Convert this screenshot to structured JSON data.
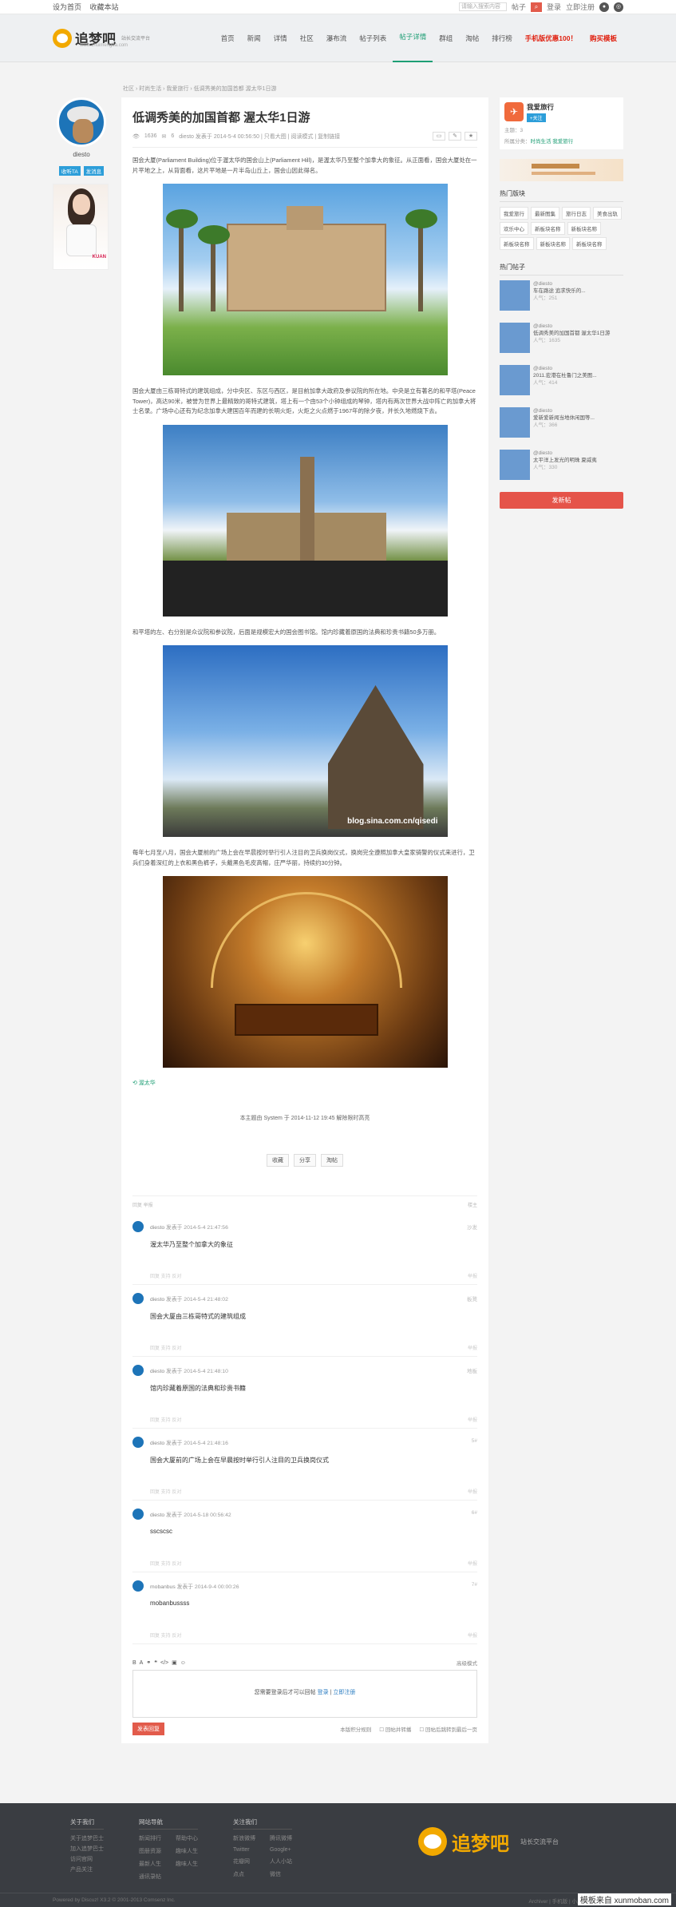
{
  "topbar": {
    "links": [
      "设为首页",
      "收藏本站"
    ],
    "search_placeholder": "请输入搜索内容",
    "search_scope": "帖子",
    "login": "登录",
    "register": "立即注册"
  },
  "header": {
    "logo_text": "追梦吧",
    "logo_sub": "站长交流平台",
    "logo_url": "www.zhuimengba.com"
  },
  "nav": [
    {
      "label": "首页"
    },
    {
      "label": "新闻"
    },
    {
      "label": "详情"
    },
    {
      "label": "社区"
    },
    {
      "label": "瀑布流"
    },
    {
      "label": "帖子列表"
    },
    {
      "label": "帖子详情",
      "active": true
    },
    {
      "label": "群组"
    },
    {
      "label": "淘帖"
    },
    {
      "label": "排行榜"
    },
    {
      "label": "手机版优惠100！",
      "red": true
    },
    {
      "label": "购买模板",
      "red": true
    }
  ],
  "breadcrumb": "社区 › 时尚生活 › 我爱旅行 › 低调秀美的加国首都 渥太华1日游",
  "author": {
    "name": "diesto",
    "btn_follow": "收听TA",
    "btn_msg": "发消息",
    "ad_tag": "KUAN"
  },
  "post": {
    "title": "低调秀美的加国首都 渥太华1日游",
    "views": "1636",
    "replies": "6",
    "meta": "diesto 发表于 2014-5-4 00:56:50 | 只看大图 | 阅读模式 | 复制链接",
    "p1": "国会大厦(Parliament Building)位于渥太华的国会山上(Parliament Hill)，是渥太华乃至整个加拿大的象征。从正面看，国会大厦处在一片平地之上，从背面看，这片平地是一片半岛山丘上，国会山因此得名。",
    "p2": "国会大厦由三栋哥特式的建筑组成，分中央区、东区与西区，是目前加拿大政府及参议院的所在地。中央是立有著名的和平塔(Peace Tower)，高达90米，被誉为世界上最精致的哥特式建筑，塔上有一个由53个小钟组成的琴钟，塔内有两次世界大战中阵亡的加拿大将士名录。广场中心还有为纪念加拿大建国百年而建的长明火炬，火炬之火点燃于1967年的除夕夜，并长久地燃烧下去。",
    "p3": "和平塔的左、右分别是众议院和参议院，后面是规模宏大的国会图书馆。馆内珍藏着原国的法典和珍贵书籍50多万册。",
    "watermark": "blog.sina.com.cn/qisedi",
    "p4": "每年七月至八月，国会大厦前的广场上会在早晨按时举行引人注目的卫兵换岗仪式，换岗完全遵照加拿大皇家骑警的仪式来进行，卫兵们身着深红的上衣和黑色裤子，头戴黑色毛皮高帽，庄严华丽，持续约30分钟。",
    "tag": "渥太华",
    "sysmsg": "本主题由 System 于 2014-11-12 19:45 解除限时高亮",
    "actions": [
      "收藏",
      "分享",
      "淘帖"
    ],
    "reply_bar_left": "回复  举报",
    "reply_bar_right": "楼主"
  },
  "comments": [
    {
      "author": "diesto",
      "time": "发表于 2014-5-4 21:47:56",
      "floor": "沙发",
      "text": "渥太华乃至整个加拿大的象征",
      "foot": "回复  支持  反对",
      "report": "举报"
    },
    {
      "author": "diesto",
      "time": "发表于 2014-5-4 21:48:02",
      "floor": "板凳",
      "text": "国会大厦由三栋哥特式的建筑组成",
      "foot": "回复  支持  反对",
      "report": "举报"
    },
    {
      "author": "diesto",
      "time": "发表于 2014-5-4 21:48:10",
      "floor": "地板",
      "text": "馆内珍藏着原国的法典和珍贵书籍",
      "foot": "回复  支持  反对",
      "report": "举报"
    },
    {
      "author": "diesto",
      "time": "发表于 2014-5-4 21:48:16",
      "floor": "5#",
      "text": "国会大厦前的广场上会在早晨按时举行引人注目的卫兵换岗仪式",
      "foot": "回复  支持  反对",
      "report": "举报"
    },
    {
      "author": "diesto",
      "time": "发表于 2014-5-18 00:56:42",
      "floor": "6#",
      "text": "sscscsc",
      "foot": "回复  支持  反对",
      "report": "举报"
    },
    {
      "author": "mobanbus",
      "time": "发表于 2014-9-4 00:00:26",
      "floor": "7#",
      "text": "mobanbussss",
      "foot": "回复  支持  反对",
      "report": "举报"
    }
  ],
  "editor": {
    "adv": "高级模式",
    "msg": "您需要登录后才可以回帖",
    "login": "登录",
    "reg": "立即注册",
    "submit": "发表回复",
    "opt1": "本版积分规则",
    "opt2": "回帖并转播",
    "opt3": "回帖后跳转到最后一页"
  },
  "sidebar": {
    "forum_name": "我爱旅行",
    "follow": "+关注",
    "topic_count": "主题：3",
    "parent_label": "所属分类：",
    "parent": "时尚生活 我爱旅行",
    "hot_blocks_title": "热门版块",
    "hot_blocks": [
      "我爱旅行",
      "最新图集",
      "旅行日志",
      "美食出轨",
      "欢乐中心",
      "新板块名称",
      "新板块名称",
      "新板块名称",
      "新板块名称",
      "新板块名称"
    ],
    "hot_posts_title": "热门帖子",
    "hot_posts": [
      {
        "user": "@diesto",
        "title": "车在路途 追求快乐的...",
        "hits": "人气：251"
      },
      {
        "user": "@diesto",
        "title": "低调秀美的加国首都 渥太华1日游",
        "hits": "人气：1635"
      },
      {
        "user": "@diesto",
        "title": "2011.宏港在杜鲁门之美图...",
        "hits": "人气：414"
      },
      {
        "user": "@diesto",
        "title": "爱新爱新闻当地休闲国等...",
        "hits": "人气：366"
      },
      {
        "user": "@diesto",
        "title": "太平洋上发光的明珠 夏威夷",
        "hits": "人气：330"
      }
    ],
    "send_btn": "发新帖"
  },
  "footer": {
    "col1_title": "关于我们",
    "col1": [
      "关于追梦巴士",
      "加入追梦巴士",
      "访问官网",
      "产品关注"
    ],
    "col2_title": "网站导航",
    "col2": [
      "新闻排行",
      "帮助中心",
      "图册资源",
      "趣味人生",
      "最新人生",
      "趣味人生",
      "通讯录帖"
    ],
    "col3_title": "关注我们",
    "col3": [
      "新浪微博",
      "腾讯微博",
      "Twitter",
      "Google+",
      "花瓣网",
      "人人小站",
      "点点",
      "微信"
    ],
    "logo": "追梦吧",
    "slogan": "站长交流平台",
    "copyright": "Powered by Discuz! X3.2  © 2001-2013 Comsenz Inc.",
    "right": "Archiver | 手机版 | 小黑屋 | Comsenz Inc.",
    "badge": "模板来自 xunmoban.com"
  }
}
